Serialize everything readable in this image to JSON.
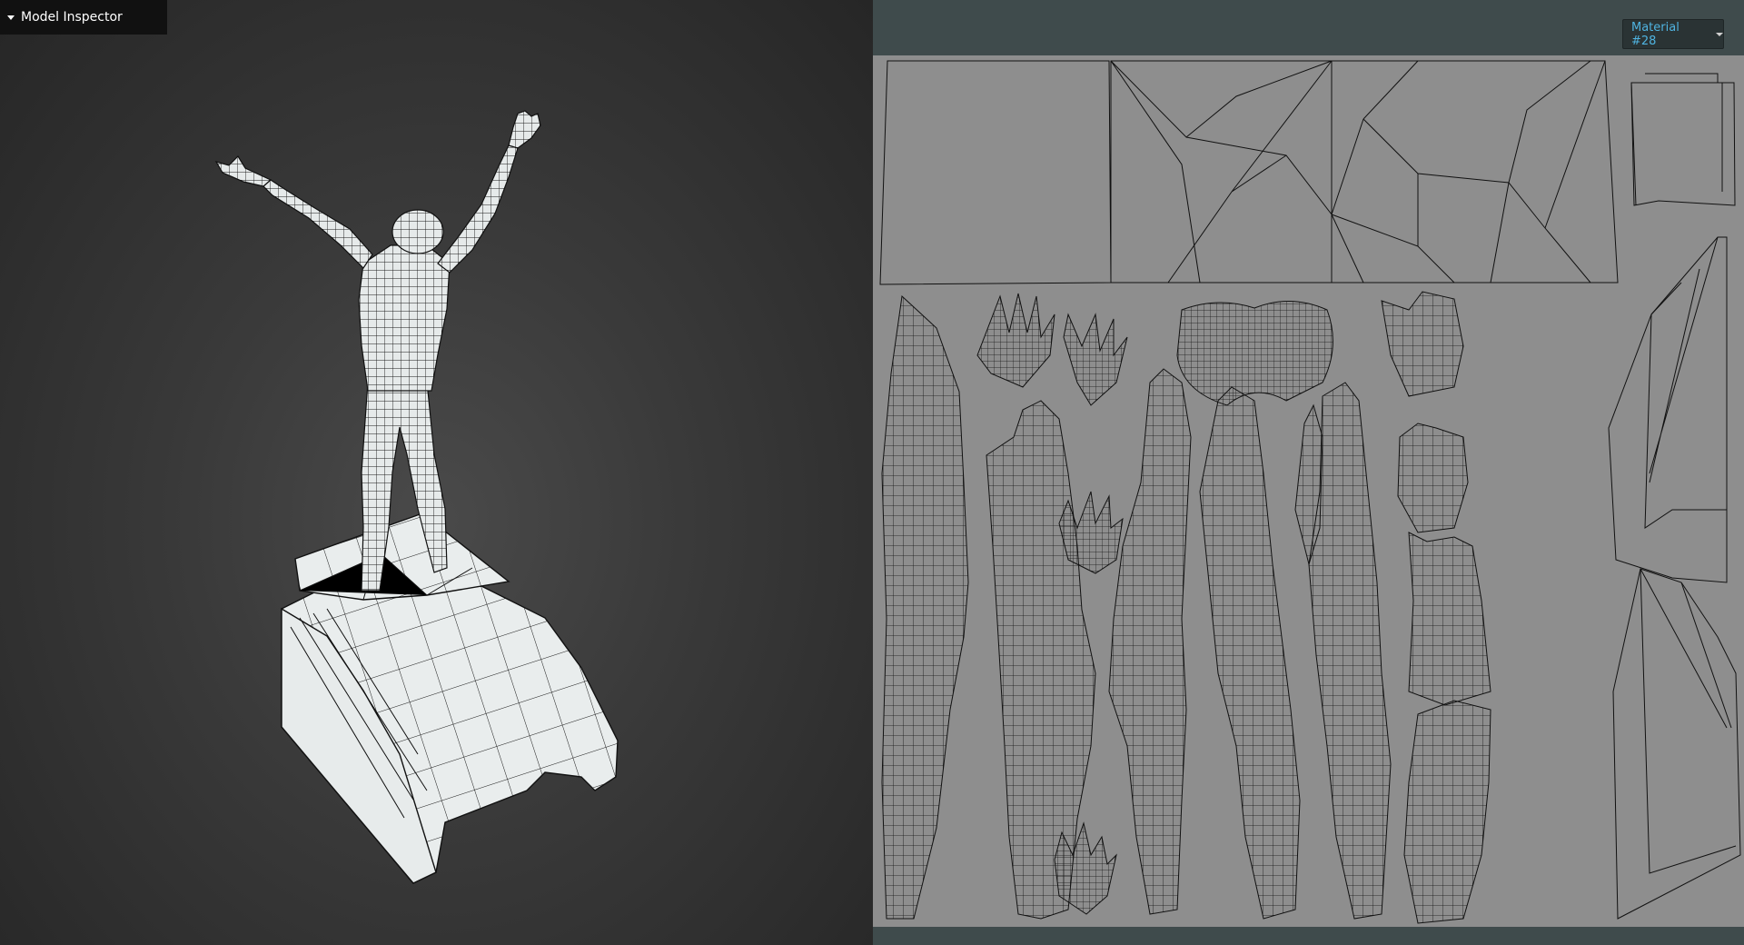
{
  "inspector": {
    "title": "Model Inspector"
  },
  "uv_editor": {
    "material_label": "Material #28"
  },
  "colors": {
    "viewport_bg": "#3a3a3a",
    "mesh_fill": "#e8ecec",
    "wire": "#111111",
    "uv_bg": "#8e8e8e",
    "panel_bg": "#3f4b4c",
    "material_text": "#4fb3e0"
  }
}
